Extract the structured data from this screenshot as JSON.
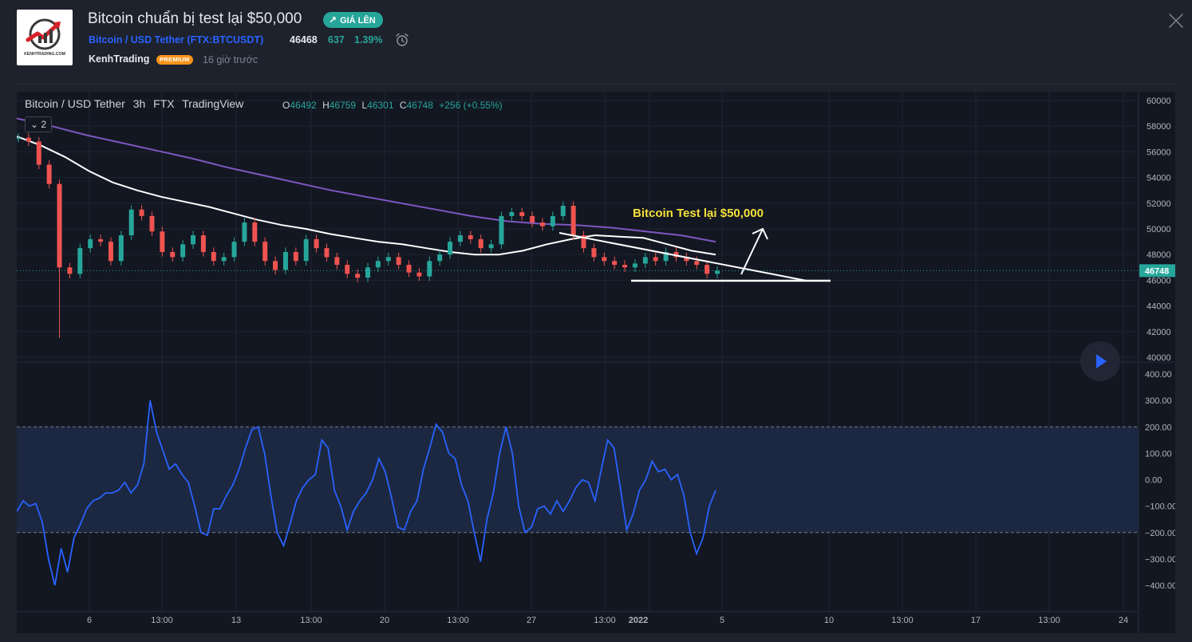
{
  "header": {
    "title": "Bitcoin chuẩn bị test lại $50,000",
    "badge": "GIÁ LÊN",
    "symbol_name": "Bitcoin / USD Tether (",
    "symbol_ticker": "FTX:BTCUSDT",
    "symbol_close": ")",
    "price": "46468",
    "change": "637",
    "change_percent": "1.39%",
    "author": "KenhTrading",
    "author_badge": "PREMIUM",
    "published": "16 giờ trước",
    "logo_text": "KENHTRADING.COM"
  },
  "chart": {
    "legend": {
      "symbol": "Bitcoin / USD Tether",
      "interval": "3h",
      "exchange": "FTX",
      "source": "TradingView",
      "o_label": "O",
      "o": "46492",
      "h_label": "H",
      "h": "46759",
      "l_label": "L",
      "l": "46301",
      "c_label": "C",
      "c": "46748",
      "change": "+256 (+0.55%)"
    },
    "collapse_count": "2",
    "annotation": "Bitcoin Test lại $50,000",
    "last_price": "46748"
  },
  "chart_data": [
    {
      "type": "candlestick",
      "y_ticks": [
        "60000",
        "58000",
        "56000",
        "54000",
        "52000",
        "50000",
        "48000",
        "46000",
        "44000",
        "42000",
        "40000"
      ],
      "ylim": [
        39500,
        60500
      ],
      "x_ticks": [
        "6",
        "13:00",
        "13",
        "13:00",
        "20",
        "13:00",
        "27",
        "13:00",
        "2022",
        "5",
        "10",
        "13:00",
        "17",
        "13:00",
        "24"
      ],
      "series": [
        {
          "name": "price",
          "values": [
            57100,
            56800,
            55000,
            53500,
            47000,
            46500,
            48500,
            49200,
            49000,
            47500,
            49500,
            51500,
            51000,
            49800,
            48200,
            47800,
            48800,
            49500,
            48200,
            47500,
            47800,
            49000,
            50500,
            49000,
            47500,
            46800,
            48200,
            47500,
            49200,
            48500,
            47800,
            47200,
            46500,
            46200,
            47000,
            47500,
            47800,
            47200,
            46600,
            46300,
            47500,
            48000,
            49000,
            49500,
            49200,
            48500,
            48800,
            51000,
            51300,
            51000,
            50500,
            50200,
            51000,
            51800,
            49500,
            48500,
            47800,
            47500,
            47200,
            47000,
            47300,
            47800,
            47500,
            48200,
            47800,
            47500,
            47200,
            46500,
            46748
          ]
        },
        {
          "name": "ma-white",
          "values": [
            57200,
            56500,
            55600,
            54500,
            53600,
            53000,
            52500,
            52100,
            51700,
            51200,
            50700,
            50300,
            50000,
            49600,
            49300,
            49000,
            48800,
            48500,
            48200,
            48000,
            48000,
            48300,
            48800,
            49200,
            49500,
            49400,
            49300,
            48800,
            48300,
            48000
          ]
        },
        {
          "name": "ma-purple",
          "values": [
            58600,
            58000,
            57300,
            56700,
            56100,
            55500,
            54800,
            54200,
            53600,
            53000,
            52500,
            52000,
            51500,
            51000,
            50600,
            50400,
            50300,
            50100,
            49800,
            49500,
            49000
          ]
        }
      ],
      "annotations": [
        "Bitcoin Test lại $50,000"
      ]
    },
    {
      "type": "line",
      "y_ticks": [
        "400.00",
        "300.00",
        "200.00",
        "100.00",
        "0.00",
        "−100.00",
        "−200.00",
        "−300.00",
        "−400.00"
      ],
      "ylim": [
        -420,
        420
      ],
      "bands": [
        -200,
        200
      ],
      "series": [
        {
          "name": "oscillator",
          "values": [
            -120,
            -80,
            -100,
            -90,
            -160,
            -300,
            -400,
            -260,
            -350,
            -220,
            -170,
            -110,
            -80,
            -70,
            -50,
            -50,
            -40,
            -10,
            -50,
            -20,
            60,
            300,
            180,
            110,
            40,
            60,
            20,
            -10,
            -100,
            -200,
            -210,
            -110,
            -110,
            -60,
            -20,
            40,
            120,
            190,
            200,
            100,
            -60,
            -200,
            -250,
            -170,
            -80,
            -30,
            0,
            20,
            150,
            120,
            -40,
            -100,
            -190,
            -120,
            -80,
            -50,
            0,
            80,
            30,
            -70,
            -180,
            -190,
            -120,
            -80,
            40,
            120,
            210,
            180,
            100,
            80,
            -20,
            -80,
            -200,
            -310,
            -150,
            -50,
            100,
            200,
            100,
            -100,
            -200,
            -180,
            -110,
            -100,
            -130,
            -80,
            -120,
            -80,
            -30,
            0,
            -10,
            -80,
            40,
            150,
            120,
            -30,
            -190,
            -130,
            -40,
            0,
            70,
            30,
            40,
            0,
            20,
            -60,
            -200,
            -280,
            -220,
            -100,
            -40
          ]
        }
      ]
    }
  ]
}
